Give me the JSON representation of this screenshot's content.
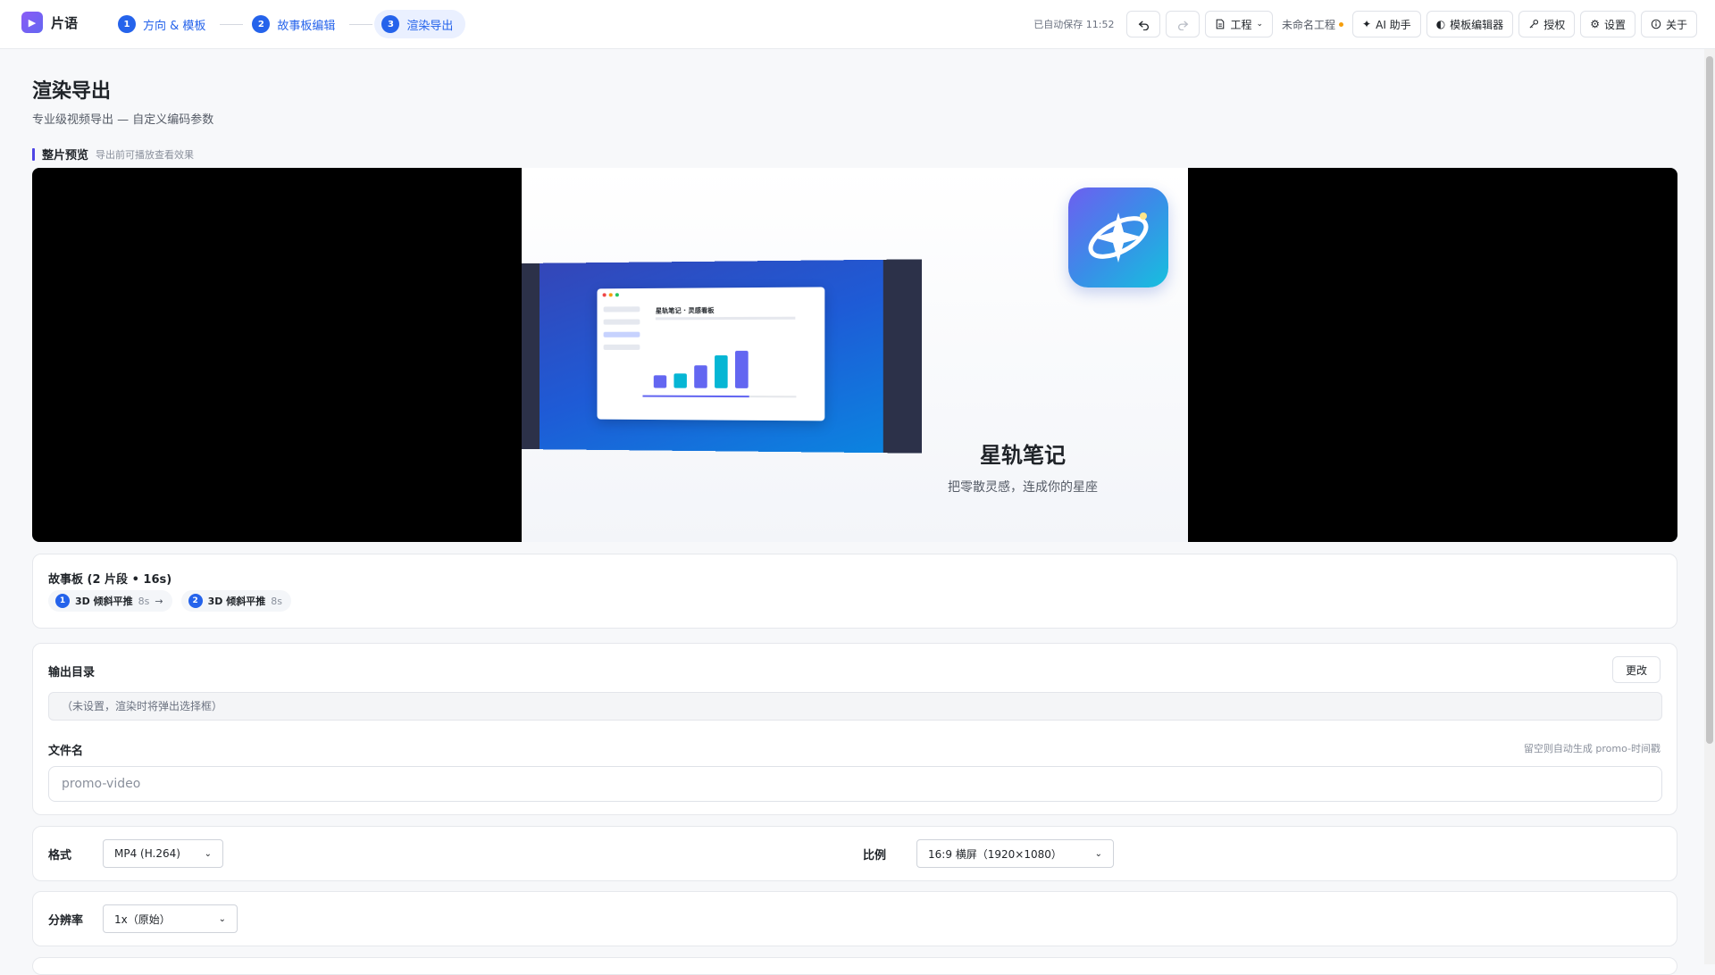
{
  "app": {
    "name": "片语",
    "logo_glyph": "▶"
  },
  "steps": [
    {
      "num": "1",
      "label": "方向 & 模板"
    },
    {
      "num": "2",
      "label": "故事板编辑"
    },
    {
      "num": "3",
      "label": "渲染导出"
    }
  ],
  "toolbar": {
    "autosave": "已自动保存 11:52",
    "project_menu": "工程",
    "project_name": "未命名工程",
    "ai": "AI 助手",
    "template_editor": "模板编辑器",
    "license": "授权",
    "settings": "设置",
    "about": "关于"
  },
  "page": {
    "title": "渲染导出",
    "subtitle": "专业级视频导出 — 自定义编码参数"
  },
  "preview": {
    "label": "整片预览",
    "hint": "导出前可播放查看效果",
    "window_title": "星轨笔记 · 灵感看板",
    "product_name": "星轨笔记",
    "tagline": "把零散灵感，连成你的星座",
    "bar_levels": [
      0.28,
      0.32,
      0.5,
      0.72,
      0.82
    ],
    "bar_colors": [
      "#6366f1",
      "#06b6d4",
      "#6366f1",
      "#06b6d4",
      "#6366f1"
    ]
  },
  "storyboard": {
    "title": "故事板 (2 片段 • 16s)",
    "arrow": "→",
    "items": [
      {
        "num": "1",
        "name": "3D 倾斜平推",
        "dur": "8s"
      },
      {
        "num": "2",
        "name": "3D 倾斜平推",
        "dur": "8s"
      }
    ]
  },
  "output": {
    "dir_label": "输出目录",
    "change": "更改",
    "dir_value": "（未设置，渲染时将弹出选择框）",
    "filename_label": "文件名",
    "filename_hint": "留空则自动生成 promo-时间戳",
    "filename_placeholder": "promo-video"
  },
  "format": {
    "label": "格式",
    "value": "MP4 (H.264)"
  },
  "ratio": {
    "label": "比例",
    "value": "16:9 横屏（1920×1080）"
  },
  "resolution": {
    "label": "分辨率",
    "value": "1x（原始）"
  },
  "colors": {
    "accent": "#2563eb",
    "brand": "#6366f1",
    "unsaved_dot": "#f59e0b"
  }
}
